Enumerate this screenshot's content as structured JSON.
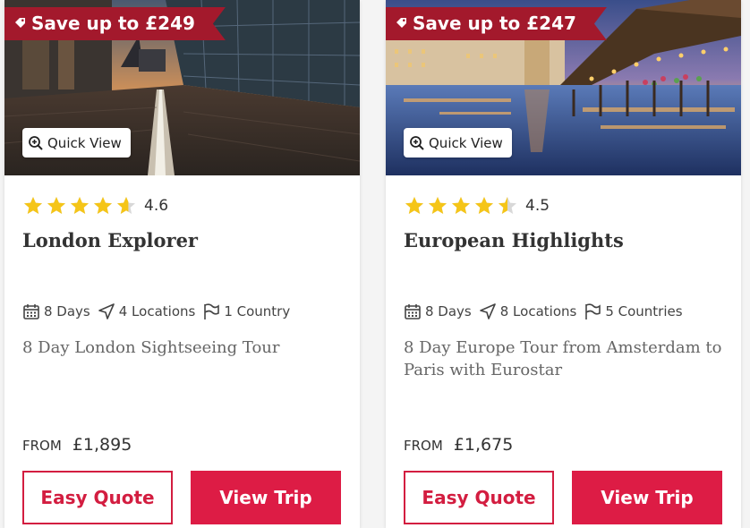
{
  "colors": {
    "accent": "#dd1c45",
    "badge": "#a3192c",
    "star": "#f5c518"
  },
  "cards": [
    {
      "badge": "Save up to £249",
      "quick_view": "Quick View",
      "rating": "4.6",
      "stars": 4.6,
      "title": "London Explorer",
      "days": "8 Days",
      "locations": "4 Locations",
      "countries": "1 Country",
      "description": "8 Day London Sightseeing Tour",
      "from_label": "FROM",
      "price": "£1,895",
      "easy_quote": "Easy Quote",
      "view_trip": "View Trip"
    },
    {
      "badge": "Save up to £247",
      "quick_view": "Quick View",
      "rating": "4.5",
      "stars": 4.5,
      "title": "European Highlights",
      "days": "8 Days",
      "locations": "8 Locations",
      "countries": "5 Countries",
      "description": "8 Day Europe Tour from Amsterdam to Paris with Eurostar",
      "from_label": "FROM",
      "price": "£1,675",
      "easy_quote": "Easy Quote",
      "view_trip": "View Trip"
    }
  ]
}
